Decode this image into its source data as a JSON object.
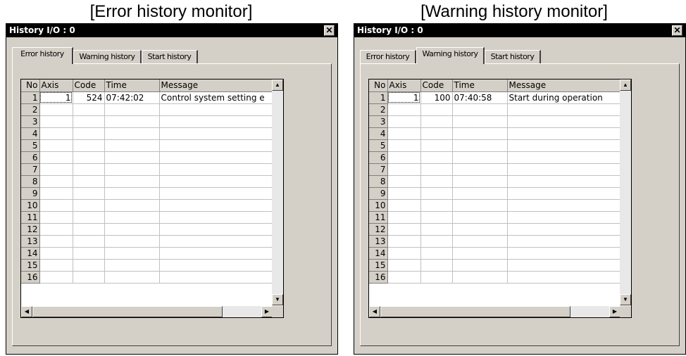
{
  "panels": [
    {
      "caption": "[Error history monitor]",
      "window_title": "History I/O : 0",
      "close_glyph": "✕",
      "tabs": [
        "Error history",
        "Warning history",
        "Start history"
      ],
      "active_tab": 0,
      "columns": [
        "No",
        "Axis",
        "Code",
        "Time",
        "Message"
      ],
      "rows": [
        {
          "no": "1",
          "axis": "1",
          "code": "524",
          "time": "07:42:02",
          "message": "Control system setting e"
        },
        {
          "no": "2"
        },
        {
          "no": "3"
        },
        {
          "no": "4"
        },
        {
          "no": "5"
        },
        {
          "no": "6"
        },
        {
          "no": "7"
        },
        {
          "no": "8"
        },
        {
          "no": "9"
        },
        {
          "no": "10"
        },
        {
          "no": "11"
        },
        {
          "no": "12"
        },
        {
          "no": "13"
        },
        {
          "no": "14"
        },
        {
          "no": "15"
        },
        {
          "no": "16"
        }
      ]
    },
    {
      "caption": "[Warning history monitor]",
      "window_title": "History I/O : 0",
      "close_glyph": "✕",
      "tabs": [
        "Error history",
        "Warning history",
        "Start history"
      ],
      "active_tab": 1,
      "columns": [
        "No",
        "Axis",
        "Code",
        "Time",
        "Message"
      ],
      "rows": [
        {
          "no": "1",
          "axis": "1",
          "code": "100",
          "time": "07:40:58",
          "message": "Start during operation"
        },
        {
          "no": "2"
        },
        {
          "no": "3"
        },
        {
          "no": "4"
        },
        {
          "no": "5"
        },
        {
          "no": "6"
        },
        {
          "no": "7"
        },
        {
          "no": "8"
        },
        {
          "no": "9"
        },
        {
          "no": "10"
        },
        {
          "no": "11"
        },
        {
          "no": "12"
        },
        {
          "no": "13"
        },
        {
          "no": "14"
        },
        {
          "no": "15"
        },
        {
          "no": "16"
        }
      ]
    }
  ],
  "icons": {
    "scroll_up": "▲",
    "scroll_down": "▼",
    "scroll_left": "◀",
    "scroll_right": "▶"
  }
}
